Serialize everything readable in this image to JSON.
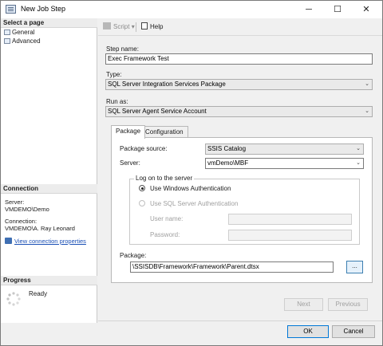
{
  "window": {
    "title": "New Job Step",
    "controls": [
      "─",
      "☐",
      "✕"
    ]
  },
  "left": {
    "select_page_header": "Select a page",
    "pages": [
      "General",
      "Advanced"
    ],
    "connection_header": "Connection",
    "server_label": "Server:",
    "server_value": "VMDEMO\\Demo",
    "connection_label": "Connection:",
    "connection_value": "VMDEMO\\A. Ray Leonard",
    "view_link": "View connection properties",
    "progress_header": "Progress",
    "progress_status": "Ready"
  },
  "toolbar": {
    "script_label": "Script",
    "script_arrow": "▾",
    "help_label": "Help"
  },
  "form": {
    "step_name_label": "Step name:",
    "step_name_value": "Exec Framework Test",
    "type_label": "Type:",
    "type_value": "SQL Server Integration Services Package",
    "run_as_label": "Run as:",
    "run_as_value": "SQL Server Agent Service Account",
    "combo_arrow": "⌄"
  },
  "tabs": [
    "Package",
    "Configuration"
  ],
  "package": {
    "source_label": "Package source:",
    "source_value": "SSIS Catalog",
    "server_label": "Server:",
    "server_value": "vmDemo\\MBF",
    "logon_title": "Log on to the server",
    "windows_auth": "Use Windows Authentication",
    "sql_auth": "Use SQL Server Authentication",
    "username_label": "User name:",
    "password_label": "Password:",
    "package_label": "Package:",
    "package_value": "\\SSISDB\\Framework\\Framework\\Parent.dtsx",
    "browse_label": "..."
  },
  "buttons": {
    "next": "Next",
    "previous": "Previous",
    "ok": "OK",
    "cancel": "Cancel"
  }
}
